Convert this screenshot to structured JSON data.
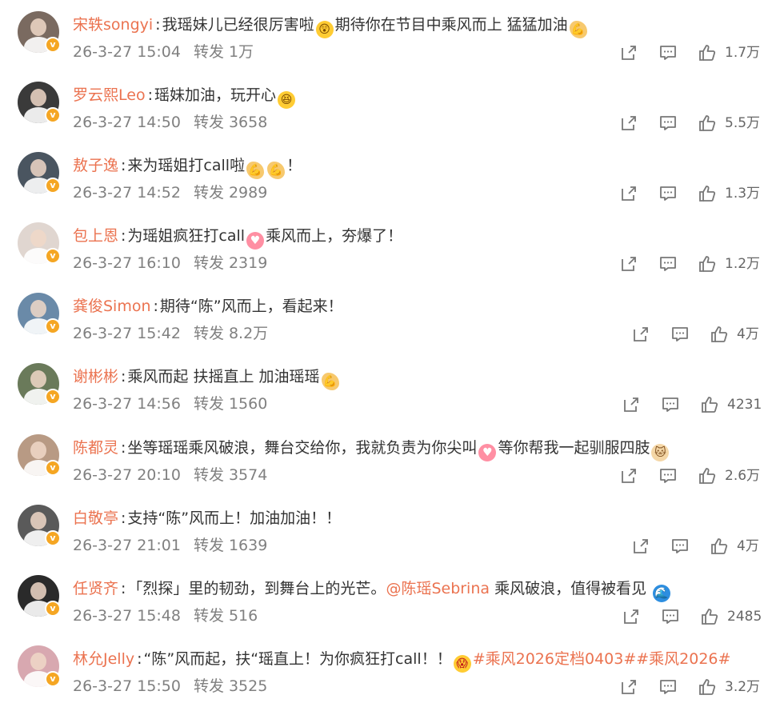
{
  "labels": {
    "forward": "转发"
  },
  "icons": {
    "share": "share-icon",
    "comment": "comment-icon",
    "like": "thumbs-up-icon",
    "verified": "verified-badge-icon"
  },
  "colors": {
    "username": "#eb7350",
    "meta": "#808080",
    "verified": "#f5a623"
  },
  "comments": [
    {
      "user": "宋轶songyi",
      "avatar_color": "#7a6a60",
      "parts": [
        {
          "t": "text",
          "v": "我瑶妹儿已经很厉害啦"
        },
        {
          "t": "emoji",
          "icon": "face",
          "ch": "😲"
        },
        {
          "t": "text",
          "v": "期待你在节目中乘风而上 猛猛加油"
        },
        {
          "t": "emoji",
          "icon": "arm",
          "ch": "💪"
        }
      ],
      "time": "26-3-27 15:04",
      "forwards": "1万",
      "likes": "1.7万"
    },
    {
      "user": "罗云熙Leo",
      "avatar_color": "#3a3a3a",
      "parts": [
        {
          "t": "text",
          "v": "瑶妹加油，玩开心"
        },
        {
          "t": "emoji",
          "icon": "face",
          "ch": "😆"
        }
      ],
      "time": "26-3-27 14:50",
      "forwards": "3658",
      "likes": "5.5万"
    },
    {
      "user": "敖子逸",
      "avatar_color": "#4a5560",
      "parts": [
        {
          "t": "text",
          "v": "来为瑶姐打call啦"
        },
        {
          "t": "emoji",
          "icon": "arm",
          "ch": "💪"
        },
        {
          "t": "emoji",
          "icon": "arm",
          "ch": "💪"
        },
        {
          "t": "text",
          "v": "！"
        }
      ],
      "time": "26-3-27 14:52",
      "forwards": "2989",
      "likes": "1.3万"
    },
    {
      "user": "包上恩",
      "avatar_color": "#e0d6d0",
      "parts": [
        {
          "t": "text",
          "v": "为瑶姐疯狂打call"
        },
        {
          "t": "emoji",
          "icon": "heart",
          "ch": "♥"
        },
        {
          "t": "text",
          "v": "乘风而上，夯爆了！"
        }
      ],
      "time": "26-3-27 16:10",
      "forwards": "2319",
      "likes": "1.2万"
    },
    {
      "user": "龚俊Simon",
      "avatar_color": "#6a8aa8",
      "parts": [
        {
          "t": "text",
          "v": "期待“陈”风而上，看起来！"
        }
      ],
      "time": "26-3-27 15:42",
      "forwards": "8.2万",
      "likes": "4万"
    },
    {
      "user": "谢彬彬",
      "avatar_color": "#6a7a5a",
      "parts": [
        {
          "t": "text",
          "v": "乘风而起 扶摇直上 加油瑶瑶"
        },
        {
          "t": "emoji",
          "icon": "arm",
          "ch": "💪"
        }
      ],
      "time": "26-3-27 14:56",
      "forwards": "1560",
      "likes": "4231"
    },
    {
      "user": "陈都灵",
      "avatar_color": "#b89a84",
      "parts": [
        {
          "t": "text",
          "v": "坐等瑶瑶乘风破浪，舞台交给你，我就负责为你尖叫"
        },
        {
          "t": "emoji",
          "icon": "heart",
          "ch": "♥"
        },
        {
          "t": "text",
          "v": "等你帮我一起驯服四肢"
        },
        {
          "t": "emoji",
          "icon": "cat",
          "ch": "🐱"
        }
      ],
      "time": "26-3-27 20:10",
      "forwards": "3574",
      "likes": "2.6万"
    },
    {
      "user": "白敬亭",
      "avatar_color": "#5a5a5a",
      "parts": [
        {
          "t": "text",
          "v": "支持“陈”风而上！加油加油！！"
        }
      ],
      "time": "26-3-27 21:01",
      "forwards": "1639",
      "likes": "4万"
    },
    {
      "user": "任贤齐",
      "avatar_color": "#2a2a2a",
      "parts": [
        {
          "t": "text",
          "v": "「烈探」里的韧劲，到舞台上的光芒。"
        },
        {
          "t": "mention",
          "v": "@陈瑶Sebrina"
        },
        {
          "t": "text",
          "v": " 乘风破浪，值得被看见 "
        },
        {
          "t": "emoji",
          "icon": "wave",
          "ch": "🌊"
        }
      ],
      "time": "26-3-27 15:48",
      "forwards": "516",
      "likes": "2485"
    },
    {
      "user": "林允Jelly",
      "avatar_color": "#d8a8b0",
      "parts": [
        {
          "t": "text",
          "v": "“陈”风而起，扶“瑶直上！为你疯狂打call！！"
        },
        {
          "t": "emoji",
          "icon": "scream",
          "ch": "😱"
        },
        {
          "t": "tag",
          "v": "#乘风2026定档0403##乘风2026#"
        }
      ],
      "time": "26-3-27 15:50",
      "forwards": "3525",
      "likes": "3.2万"
    }
  ]
}
